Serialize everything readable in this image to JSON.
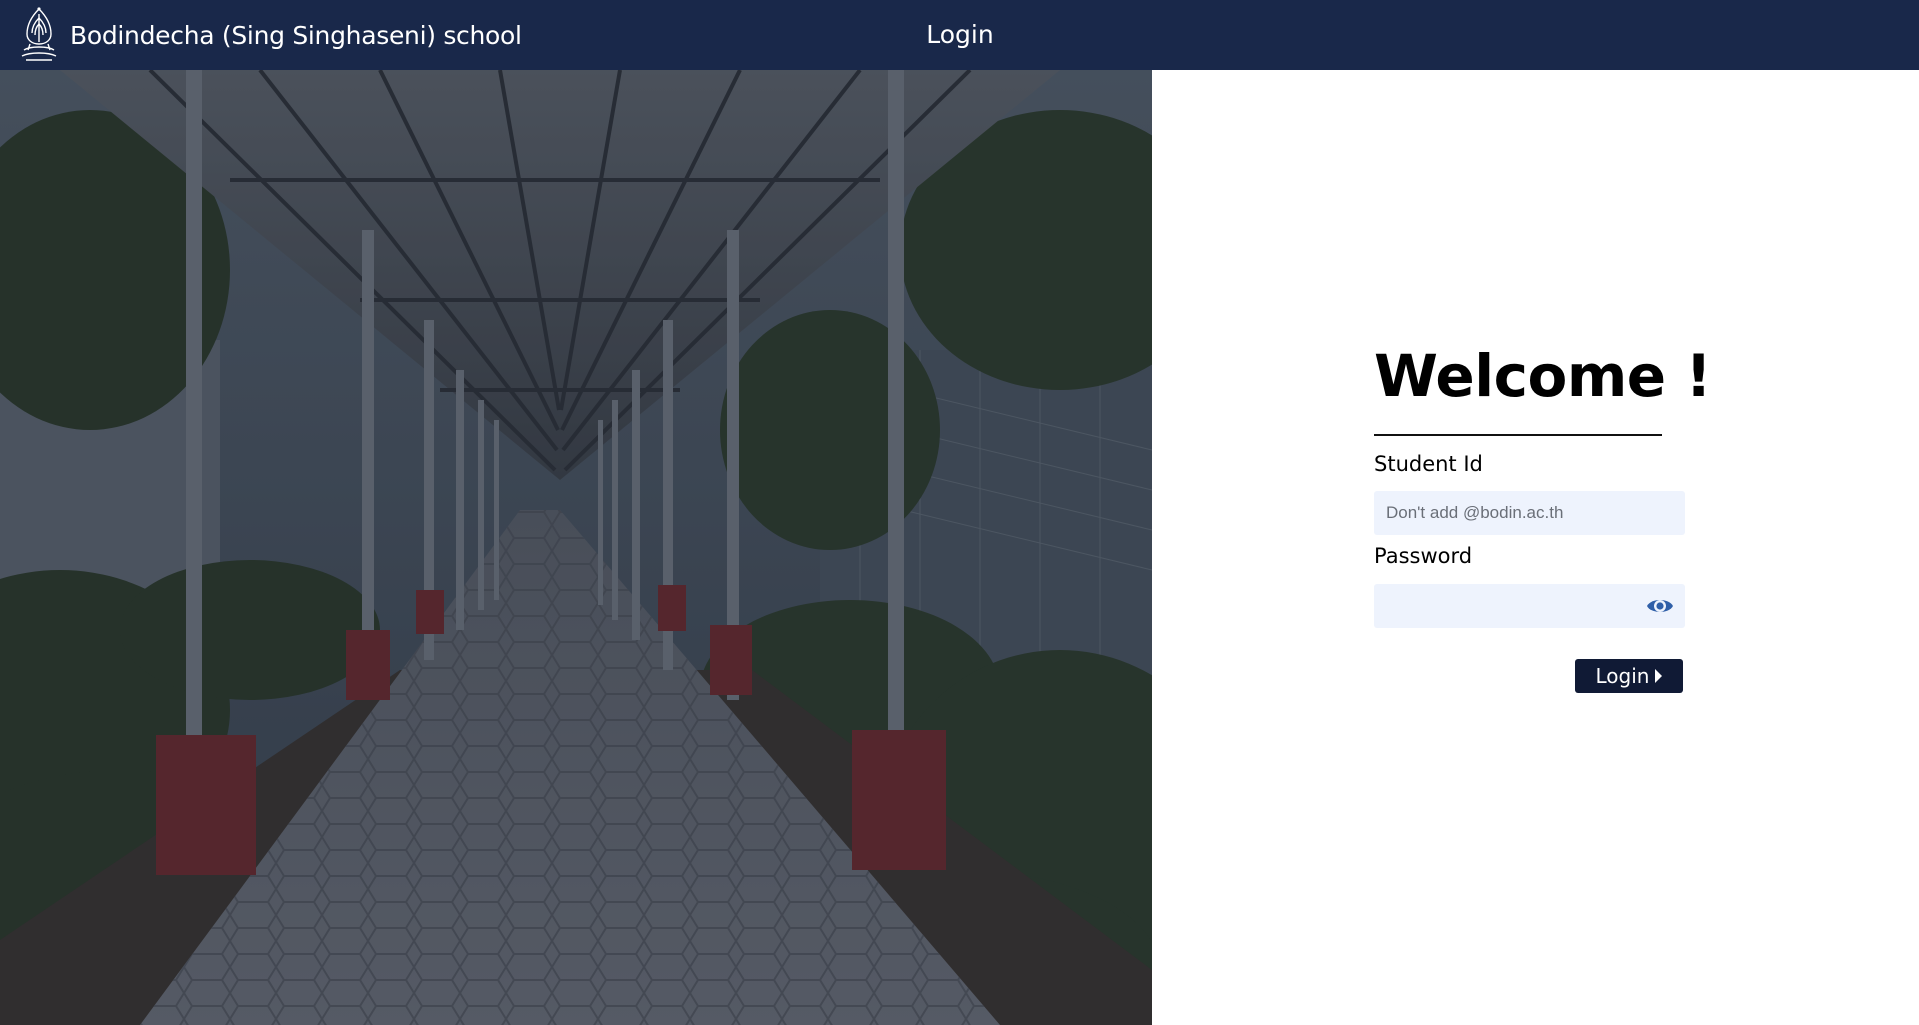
{
  "navbar": {
    "school_name": "Bodindecha (Sing Singhaseni) school",
    "page_title": "Login",
    "logo_icon": "school-crest-logo",
    "background_color": "#19284a"
  },
  "login_form": {
    "heading": "Welcome !",
    "student_id": {
      "label": "Student Id",
      "placeholder": "Don't add @bodin.ac.th",
      "value": ""
    },
    "password": {
      "label": "Password",
      "value": "",
      "toggle_icon": "eye-icon"
    },
    "submit": {
      "label": "Login",
      "icon": "caret-right-icon",
      "color": "#101a35"
    },
    "input_background": "#eef3fd",
    "accent_color": "#2f5fa8"
  },
  "hero": {
    "image_subject": "covered-walkway-photo"
  }
}
